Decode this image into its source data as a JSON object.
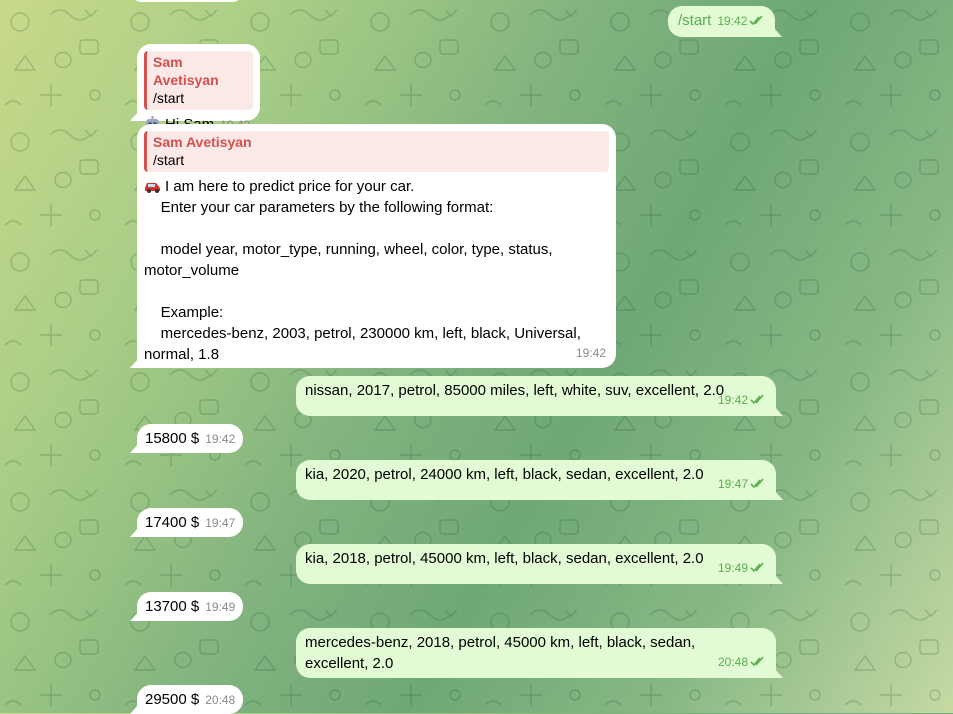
{
  "colors": {
    "incoming_bubble": "#ffffff",
    "outgoing_bubble": "#e2fbd4",
    "quote_accent": "#d2514f",
    "time_outgoing": "#5aae4e"
  },
  "messages": {
    "m1": {
      "text": "/start",
      "time": "19:42",
      "status": "read"
    },
    "m2": {
      "quote_author": "Sam Avetisyan",
      "quote_text": "/start",
      "emoji": "robot-icon",
      "text": "Hi Sam",
      "time": "19:42"
    },
    "m3": {
      "quote_author": "Sam Avetisyan",
      "quote_text": "/start",
      "emoji": "red-car-icon",
      "lines": [
        "I am here to predict price for your car.",
        "    Enter your car parameters by the following format:",
        "",
        "    model year, motor_type, running, wheel, color, type, status, motor_volume",
        "",
        "    Example:",
        "    mercedes-benz, 2003, petrol, 230000 km, left, black, Universal, normal, 1.8"
      ],
      "time": "19:42"
    },
    "m4": {
      "text": "nissan, 2017, petrol, 85000 miles, left, white, suv, excellent, 2.0",
      "time": "19:42",
      "status": "read"
    },
    "m5": {
      "text": "15800 $",
      "time": "19:42"
    },
    "m6": {
      "text": "kia, 2020, petrol, 24000 km, left, black, sedan, excellent, 2.0",
      "time": "19:47",
      "status": "read"
    },
    "m7": {
      "text": "17400 $",
      "time": "19:47"
    },
    "m8": {
      "text": "kia, 2018, petrol, 45000 km, left, black, sedan, excellent, 2.0",
      "time": "19:49",
      "status": "read"
    },
    "m9": {
      "text": "13700 $",
      "time": "19:49"
    },
    "m10": {
      "text": "mercedes-benz, 2018, petrol, 45000 km, left, black, sedan, excellent, 2.0",
      "time": "20:48",
      "status": "read"
    },
    "m11": {
      "text": "29500 $",
      "time": "20:48"
    }
  }
}
